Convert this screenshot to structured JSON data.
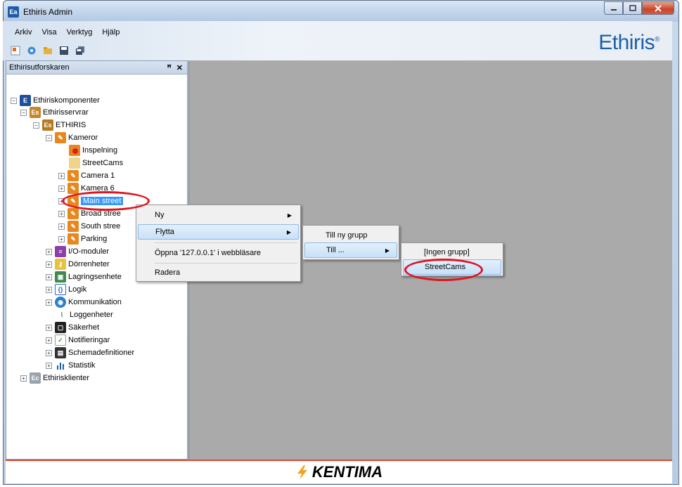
{
  "window": {
    "title": "Ethiris Admin",
    "app_icon": "Ea"
  },
  "menubar": {
    "items": [
      "Arkiv",
      "Visa",
      "Verktyg",
      "Hjälp"
    ]
  },
  "toolbar": {
    "icons": [
      "new-icon",
      "settings-icon",
      "open-folder-icon",
      "save-icon",
      "save-all-icon"
    ]
  },
  "brand": {
    "logo": "Ethiris",
    "mark": "®"
  },
  "explorer": {
    "title": "Ethirisutforskaren",
    "pin": "ꟸ",
    "close": "✕",
    "tree": [
      {
        "label": "Ethiriskomponenter",
        "icon": "E"
      },
      {
        "label": "Ethirisservrar",
        "icon": "Es"
      },
      {
        "label": "ETHIRIS",
        "icon": "Es"
      },
      {
        "label": "Kameror"
      },
      {
        "label": "Inspelning"
      },
      {
        "label": "StreetCams"
      },
      {
        "label": "Camera 1"
      },
      {
        "label": "Kamera 6"
      },
      {
        "label": "Main street"
      },
      {
        "label": "Broad stree"
      },
      {
        "label": "South stree"
      },
      {
        "label": "Parking"
      },
      {
        "label": "I/O-moduler"
      },
      {
        "label": "Dörrenheter"
      },
      {
        "label": "Lagringsenhete"
      },
      {
        "label": "Logik"
      },
      {
        "label": "Kommunikation"
      },
      {
        "label": "Loggenheter"
      },
      {
        "label": "Säkerhet"
      },
      {
        "label": "Notifieringar"
      },
      {
        "label": "Schemadefinitioner"
      },
      {
        "label": "Statistik"
      },
      {
        "label": "Ethirisklienter",
        "icon": "Ec"
      }
    ]
  },
  "context_menu": {
    "items": [
      "Ny",
      "Flytta",
      "Öppna '127.0.0.1' i webbläsare",
      "Radera"
    ]
  },
  "submenu_flytta": {
    "items": [
      "Till ny grupp",
      "Till ..."
    ]
  },
  "submenu_till": {
    "items": [
      "[Ingen grupp]",
      "StreetCams"
    ]
  },
  "footer": {
    "brand": "KENTIMA"
  },
  "colors": {
    "accent": "#3399ff",
    "highlight_ring": "#e0141e",
    "workspace": "#aaaaaa",
    "brand_blue": "#1b5fa8"
  }
}
